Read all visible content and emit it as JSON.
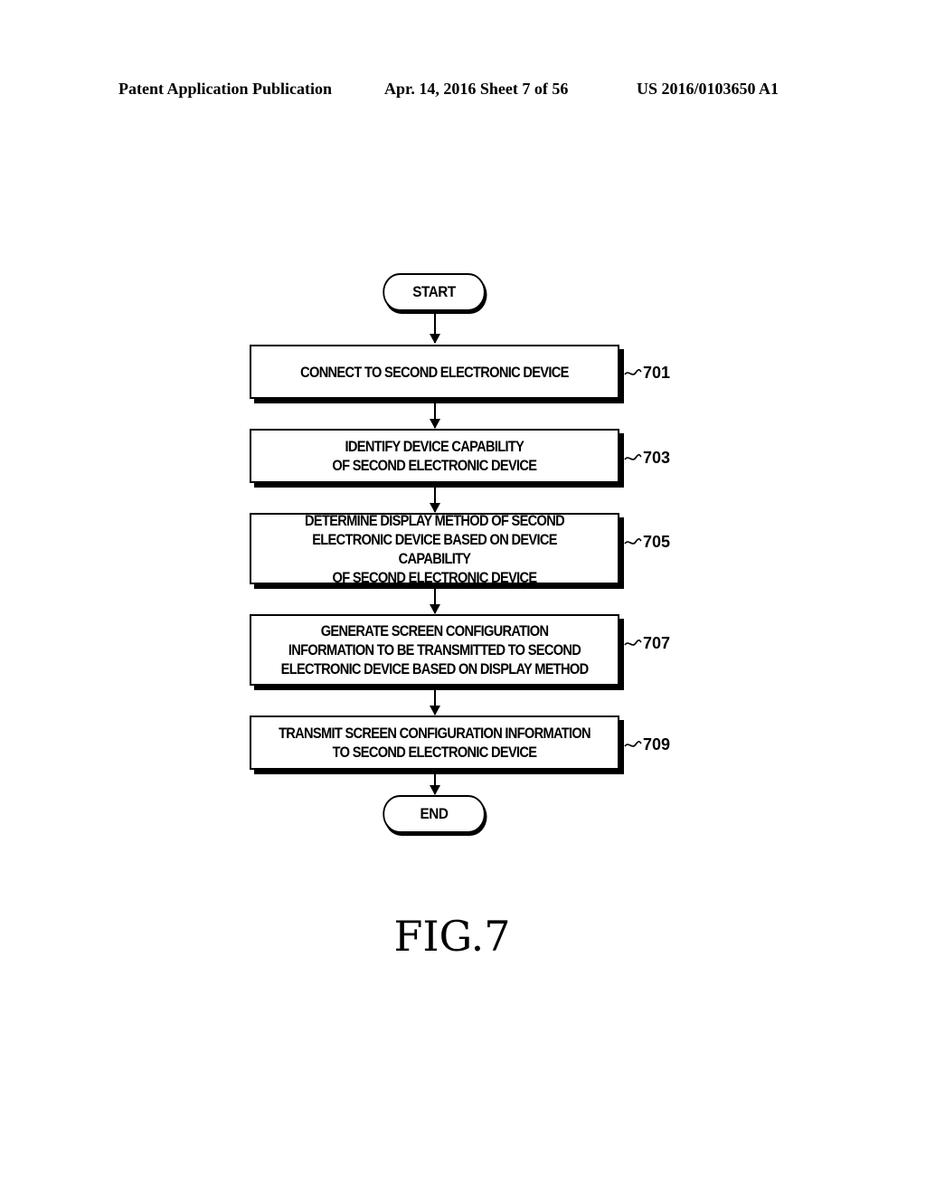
{
  "header": {
    "left": "Patent Application Publication",
    "middle": "Apr. 14, 2016  Sheet 7 of 56",
    "right": "US 2016/0103650 A1"
  },
  "flowchart": {
    "start": "START",
    "end": "END",
    "steps": [
      {
        "ref": "701",
        "text": "CONNECT TO SECOND ELECTRONIC DEVICE"
      },
      {
        "ref": "703",
        "text": "IDENTIFY DEVICE CAPABILITY\nOF SECOND ELECTRONIC DEVICE"
      },
      {
        "ref": "705",
        "text": "DETERMINE DISPLAY METHOD OF SECOND\nELECTRONIC DEVICE BASED ON DEVICE CAPABILITY\nOF SECOND ELECTRONIC DEVICE"
      },
      {
        "ref": "707",
        "text": "GENERATE SCREEN CONFIGURATION\nINFORMATION TO BE TRANSMITTED TO SECOND\nELECTRONIC DEVICE BASED ON DISPLAY METHOD"
      },
      {
        "ref": "709",
        "text": "TRANSMIT SCREEN CONFIGURATION INFORMATION\nTO SECOND ELECTRONIC DEVICE"
      }
    ]
  },
  "figure_label": "FIG.7"
}
